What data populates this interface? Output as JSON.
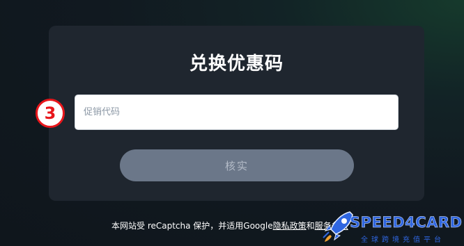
{
  "redeem_card": {
    "title": "兑换优惠码",
    "promo_input": {
      "placeholder": "促销代码",
      "value": ""
    },
    "verify_button": {
      "label": "核实"
    }
  },
  "annotation": {
    "step_marker": "3"
  },
  "footer": {
    "prefix": "本网站受 reCaptcha 保护，并适用Google",
    "privacy_link": "隐私政策",
    "and": "和",
    "terms_link": "服务条款"
  },
  "watermark": {
    "brand": "SPEED4CARD",
    "tagline": "全球跨境充值平台"
  },
  "colors": {
    "background": "#111920",
    "card": "#1f262f",
    "button": "#6b7789",
    "marker": "#e8161b",
    "brand_blue": "#2f66e0"
  }
}
